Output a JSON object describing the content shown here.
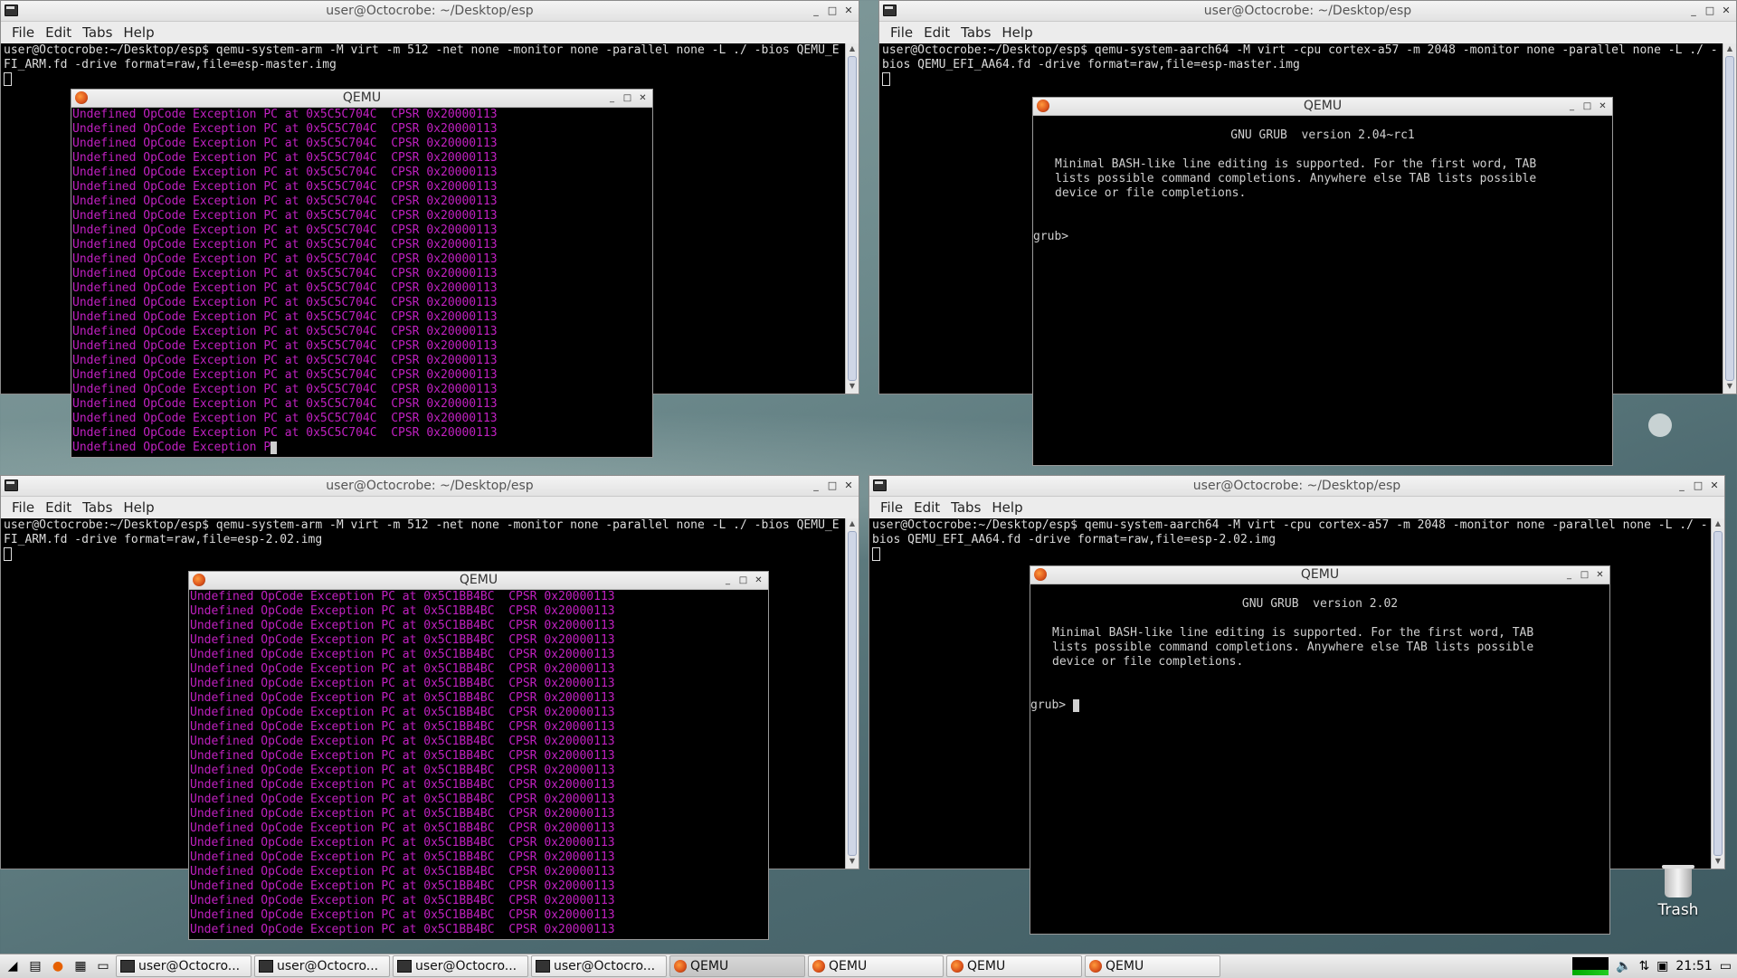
{
  "window_title": "user@Octocrobe: ~/Desktop/esp",
  "menu": [
    "File",
    "Edit",
    "Tabs",
    "Help"
  ],
  "qemu_title": "QEMU",
  "terms": {
    "tl": "user@Octocrobe:~/Desktop/esp$ qemu-system-arm -M virt -m 512 -net none -monitor none -parallel none -L ./ -bios QEMU_EFI_ARM.fd -drive format=raw,file=esp-master.img",
    "tr": "user@Octocrobe:~/Desktop/esp$ qemu-system-aarch64 -M virt -cpu cortex-a57 -m 2048 -monitor none -parallel none -L ./ -bios QEMU_EFI_AA64.fd -drive format=raw,file=esp-master.img",
    "bl": "user@Octocrobe:~/Desktop/esp$ qemu-system-arm -M virt -m 512 -net none -monitor none -parallel none -L ./ -bios QEMU_EFI_ARM.fd -drive format=raw,file=esp-2.02.img",
    "br": "user@Octocrobe:~/Desktop/esp$ qemu-system-aarch64 -M virt -cpu cortex-a57 -m 2048 -monitor none -parallel none -L ./ -bios QEMU_EFI_AA64.fd -drive format=raw,file=esp-2.02.img"
  },
  "qemu_tl": {
    "line": "Undefined OpCode Exception PC at 0x5C5C704C  CPSR 0x20000113",
    "last": "Undefined OpCode Exception P",
    "count": 23
  },
  "qemu_bl": {
    "line": "Undefined OpCode Exception PC at 0x5C1BB4BC  CPSR 0x20000113",
    "count": 24
  },
  "grub_tr": {
    "version": "GNU GRUB  version 2.04~rc1",
    "help": "Minimal BASH-like line editing is supported. For the first word, TAB\nlists possible command completions. Anywhere else TAB lists possible\ndevice or file completions.",
    "prompt": "grub>"
  },
  "grub_br": {
    "version": "GNU GRUB  version 2.02",
    "help": "Minimal BASH-like line editing is supported. For the first word, TAB\nlists possible command completions. Anywhere else TAB lists possible\ndevice or file completions.",
    "prompt": "grub>"
  },
  "trash_label": "Trash",
  "taskbar": {
    "tasks": [
      "user@Octocro...",
      "user@Octocro...",
      "user@Octocro...",
      "user@Octocro...",
      "QEMU",
      "QEMU",
      "QEMU",
      "QEMU"
    ],
    "clock": "21:51"
  }
}
